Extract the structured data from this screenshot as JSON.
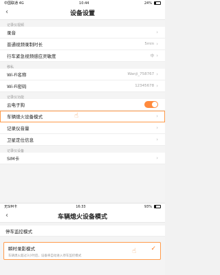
{
  "top": {
    "status": {
      "carrier": "中国联通 4G",
      "time": "10:44",
      "battery": "24%"
    },
    "nav": {
      "back": "‹",
      "title": "设备设置"
    },
    "sections": [
      {
        "header": "记录仪视频",
        "rows": [
          {
            "label": "录音",
            "value": "",
            "kind": "chevron"
          },
          {
            "label": "普通视频录制时长",
            "value": "5min",
            "kind": "chevron"
          },
          {
            "label": "行车紧急视频感应灵敏度",
            "value": "中",
            "kind": "chevron"
          }
        ]
      },
      {
        "header": "移私",
        "rows": [
          {
            "label": "Wi-Fi名称",
            "value": "Wanji_758767",
            "kind": "chevron"
          },
          {
            "label": "Wi-Fi密码",
            "value": "12345678",
            "kind": "chevron"
          }
        ]
      },
      {
        "header": "记录仪功能",
        "rows": [
          {
            "label": "云电子狗",
            "value": "",
            "kind": "toggle",
            "on": true
          },
          {
            "label": "车辆熄火设备模式",
            "value": "",
            "kind": "chevron",
            "highlight": true
          },
          {
            "label": "记录仪音量",
            "value": "",
            "kind": "chevron"
          },
          {
            "label": "卫星定位信息",
            "value": "",
            "kind": "chevron"
          }
        ]
      },
      {
        "header": "记录仪设备",
        "rows": [
          {
            "label": "SIM卡",
            "value": "",
            "kind": "chevron"
          }
        ]
      }
    ],
    "chevron": "›",
    "pointer_icon": "hand-pointer-icon"
  },
  "bottom": {
    "status": {
      "carrier": "无SIM卡",
      "time": "16:33",
      "battery": "93%"
    },
    "nav": {
      "back": "‹",
      "title": "车辆熄火设备模式"
    },
    "option1": "停车监控模式",
    "option2": {
      "title": "瞬时录影模式",
      "desc": "车辆熄火超过3小时后，设备将自动进入停车监控模式",
      "check": "✓"
    }
  },
  "colors": {
    "accent": "#ff8a3d"
  }
}
